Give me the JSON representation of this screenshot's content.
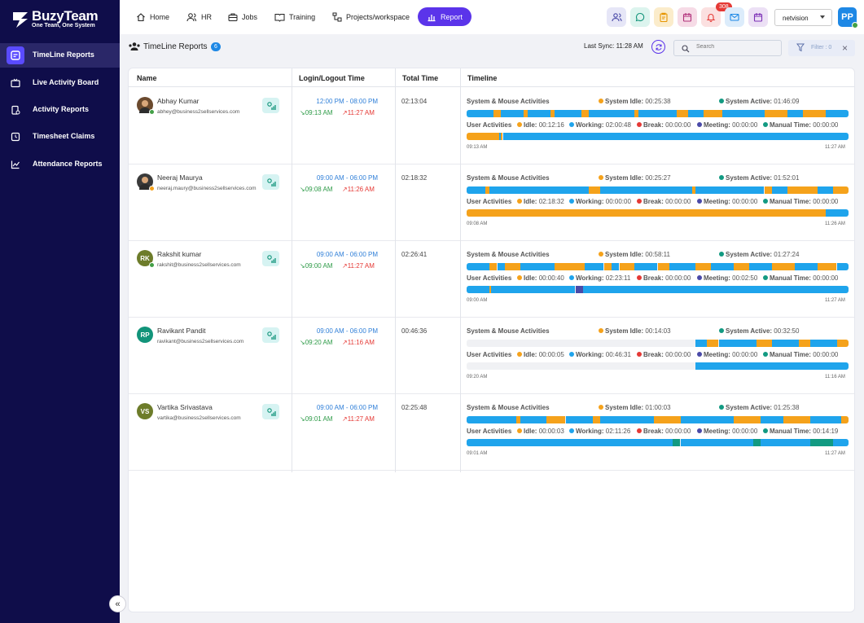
{
  "brand": {
    "name": "BuzyTeam",
    "tagline": "One Team, One System"
  },
  "sidebar": {
    "items": [
      {
        "label": "TimeLine Reports",
        "icon": "timeline-icon"
      },
      {
        "label": "Live Activity Board",
        "icon": "tv-icon"
      },
      {
        "label": "Activity Reports",
        "icon": "report-icon"
      },
      {
        "label": "Timesheet Claims",
        "icon": "clock-icon"
      },
      {
        "label": "Attendance Reports",
        "icon": "graph-icon"
      }
    ],
    "collapse": "«"
  },
  "topnav": {
    "items": [
      {
        "label": "Home",
        "icon": "home-icon"
      },
      {
        "label": "HR",
        "icon": "people-icon"
      },
      {
        "label": "Jobs",
        "icon": "briefcase-icon"
      },
      {
        "label": "Training",
        "icon": "book-icon"
      },
      {
        "label": "Projects/workspace",
        "icon": "workspace-icon"
      },
      {
        "label": "Report",
        "icon": "bar-chart-icon"
      }
    ],
    "notification_count": "308",
    "org_select": "netvision",
    "avatar": "PP"
  },
  "page": {
    "title": "TimeLine Reports",
    "count": "6",
    "last_sync": "Last Sync: 11:28 AM",
    "search_placeholder": "Search",
    "filter_label": "Filter : 0"
  },
  "table": {
    "headers": {
      "name": "Name",
      "login": "Login/Logout Time",
      "total": "Total Time",
      "timeline": "Timeline"
    },
    "labels": {
      "system": "System & Mouse Activities",
      "system_idle": "System Idle:",
      "system_active": "System Active:",
      "user": "User Activities",
      "idle": "Idle:",
      "working": "Working:",
      "break": "Break:",
      "meeting": "Meeting:",
      "manual": "Manual Time:"
    },
    "colors": {
      "active": "#1fa4ec",
      "idle": "#f5a21b",
      "break": "#e53935",
      "meeting": "#4a4aa8",
      "manual": "#129a82"
    },
    "rows": [
      {
        "name": "Abhay Kumar",
        "email": "abhey@business2sellservices.com",
        "avatar": "photo",
        "avatar_bg": "#6b4a2e",
        "status": "#43a047",
        "shift": "12:00 PM - 08:00 PM",
        "login": "09:13 AM",
        "logout": "11:27 AM",
        "total": "02:13:04",
        "system_idle": "00:25:38",
        "system_active": "01:46:09",
        "idle": "00:12:16",
        "working": "02:00:48",
        "break": "00:00:00",
        "meeting": "00:00:00",
        "manual": "00:00:00",
        "start": "09:13 AM",
        "end": "11:27 AM",
        "sys_bar": [
          [
            0,
            0.07,
            "a"
          ],
          [
            0.07,
            0.09,
            "i"
          ],
          [
            0.09,
            0.15,
            "a"
          ],
          [
            0.15,
            0.16,
            "i"
          ],
          [
            0.16,
            0.22,
            "a"
          ],
          [
            0.22,
            0.23,
            "i"
          ],
          [
            0.23,
            0.3,
            "a"
          ],
          [
            0.3,
            0.32,
            "i"
          ],
          [
            0.32,
            0.44,
            "a"
          ],
          [
            0.44,
            0.45,
            "i"
          ],
          [
            0.45,
            0.55,
            "a"
          ],
          [
            0.55,
            0.58,
            "i"
          ],
          [
            0.58,
            0.62,
            "a"
          ],
          [
            0.62,
            0.67,
            "i"
          ],
          [
            0.67,
            0.78,
            "a"
          ],
          [
            0.78,
            0.84,
            "i"
          ],
          [
            0.84,
            0.88,
            "a"
          ],
          [
            0.88,
            0.94,
            "i"
          ],
          [
            0.94,
            1,
            "a"
          ]
        ],
        "usr_bar": [
          [
            0,
            0.085,
            "i"
          ],
          [
            0.085,
            0.09,
            "a"
          ],
          [
            0.09,
            0.095,
            "i"
          ],
          [
            0.095,
            1,
            "a"
          ]
        ]
      },
      {
        "name": "Neeraj Maurya",
        "email": "neeraj.maury@business2sellservices.com",
        "avatar": "photo",
        "avatar_bg": "#3a3a3a",
        "status": "#f5a21b",
        "shift": "09:00 AM - 06:00 PM",
        "login": "09:08 AM",
        "logout": "11:26 AM",
        "total": "02:18:32",
        "system_idle": "00:25:27",
        "system_active": "01:52:01",
        "idle": "02:18:32",
        "working": "00:00:00",
        "break": "00:00:00",
        "meeting": "00:00:00",
        "manual": "00:00:00",
        "start": "09:08 AM",
        "end": "11:26 AM",
        "sys_bar": [
          [
            0,
            0.05,
            "a"
          ],
          [
            0.05,
            0.06,
            "i"
          ],
          [
            0.06,
            0.32,
            "a"
          ],
          [
            0.32,
            0.35,
            "i"
          ],
          [
            0.35,
            0.59,
            "a"
          ],
          [
            0.59,
            0.6,
            "i"
          ],
          [
            0.6,
            0.78,
            "a"
          ],
          [
            0.78,
            0.8,
            "i"
          ],
          [
            0.8,
            0.84,
            "a"
          ],
          [
            0.84,
            0.92,
            "i"
          ],
          [
            0.92,
            0.96,
            "a"
          ],
          [
            0.96,
            1,
            "i"
          ]
        ],
        "usr_bar": [
          [
            0,
            0.94,
            "i"
          ],
          [
            0.94,
            1,
            "a"
          ]
        ]
      },
      {
        "name": "Rakshit kumar",
        "email": "rakshit@business2sellservices.com",
        "avatar": "RK",
        "avatar_bg": "#6d7c2a",
        "status": "#43a047",
        "shift": "09:00 AM - 06:00 PM",
        "login": "09:00 AM",
        "logout": "11:27 AM",
        "total": "02:26:41",
        "system_idle": "00:58:11",
        "system_active": "01:27:24",
        "idle": "00:00:40",
        "working": "02:23:11",
        "break": "00:00:00",
        "meeting": "00:02:50",
        "manual": "00:00:00",
        "start": "09:00 AM",
        "end": "11:27 AM",
        "sys_bar": [
          [
            0,
            0.06,
            "a"
          ],
          [
            0.06,
            0.08,
            "i"
          ],
          [
            0.08,
            0.1,
            "a"
          ],
          [
            0.1,
            0.14,
            "i"
          ],
          [
            0.14,
            0.23,
            "a"
          ],
          [
            0.23,
            0.31,
            "i"
          ],
          [
            0.31,
            0.36,
            "a"
          ],
          [
            0.36,
            0.38,
            "i"
          ],
          [
            0.38,
            0.4,
            "a"
          ],
          [
            0.4,
            0.44,
            "i"
          ],
          [
            0.44,
            0.5,
            "a"
          ],
          [
            0.5,
            0.53,
            "i"
          ],
          [
            0.53,
            0.6,
            "a"
          ],
          [
            0.6,
            0.64,
            "i"
          ],
          [
            0.64,
            0.7,
            "a"
          ],
          [
            0.7,
            0.74,
            "i"
          ],
          [
            0.74,
            0.8,
            "a"
          ],
          [
            0.8,
            0.86,
            "i"
          ],
          [
            0.86,
            0.92,
            "a"
          ],
          [
            0.92,
            0.97,
            "i"
          ],
          [
            0.97,
            1,
            "a"
          ]
        ],
        "usr_bar": [
          [
            0,
            0.06,
            "a"
          ],
          [
            0.06,
            0.065,
            "i"
          ],
          [
            0.065,
            0.285,
            "a"
          ],
          [
            0.285,
            0.305,
            "m"
          ],
          [
            0.305,
            1,
            "a"
          ]
        ]
      },
      {
        "name": "Ravikant Pandit",
        "email": "ravikant@business2sellservices.com",
        "avatar": "RP",
        "avatar_bg": "#12947a",
        "status": "",
        "shift": "09:00 AM - 06:00 PM",
        "login": "09:20 AM",
        "logout": "11:16 AM",
        "total": "00:46:36",
        "system_idle": "00:14:03",
        "system_active": "00:32:50",
        "idle": "00:00:05",
        "working": "00:46:31",
        "break": "00:00:00",
        "meeting": "00:00:00",
        "manual": "00:00:00",
        "start": "09:20 AM",
        "end": "11:16 AM",
        "sys_bar": [
          [
            0.6,
            0.63,
            "a"
          ],
          [
            0.63,
            0.66,
            "i"
          ],
          [
            0.66,
            0.76,
            "a"
          ],
          [
            0.76,
            0.8,
            "i"
          ],
          [
            0.8,
            0.87,
            "a"
          ],
          [
            0.87,
            0.9,
            "i"
          ],
          [
            0.9,
            0.97,
            "a"
          ],
          [
            0.97,
            1,
            "i"
          ]
        ],
        "usr_bar": [
          [
            0.6,
            1,
            "a"
          ]
        ]
      },
      {
        "name": "Vartika Srivastava",
        "email": "vartika@business2sellservices.com",
        "avatar": "VS",
        "avatar_bg": "#6d7c2a",
        "status": "",
        "shift": "09:00 AM - 06:00 PM",
        "login": "09:01 AM",
        "logout": "11:27 AM",
        "total": "02:25:48",
        "system_idle": "01:00:03",
        "system_active": "01:25:38",
        "idle": "00:00:03",
        "working": "02:11:26",
        "break": "00:00:00",
        "meeting": "00:00:00",
        "manual": "00:14:19",
        "start": "09:01 AM",
        "end": "11:27 AM",
        "sys_bar": [
          [
            0,
            0.13,
            "a"
          ],
          [
            0.13,
            0.14,
            "i"
          ],
          [
            0.14,
            0.21,
            "a"
          ],
          [
            0.21,
            0.26,
            "i"
          ],
          [
            0.26,
            0.33,
            "a"
          ],
          [
            0.33,
            0.35,
            "i"
          ],
          [
            0.35,
            0.49,
            "a"
          ],
          [
            0.49,
            0.56,
            "i"
          ],
          [
            0.56,
            0.7,
            "a"
          ],
          [
            0.7,
            0.77,
            "i"
          ],
          [
            0.77,
            0.83,
            "a"
          ],
          [
            0.83,
            0.9,
            "i"
          ],
          [
            0.9,
            0.98,
            "a"
          ],
          [
            0.98,
            1,
            "i"
          ]
        ],
        "usr_bar": [
          [
            0,
            0.54,
            "a"
          ],
          [
            0.54,
            0.56,
            "g"
          ],
          [
            0.56,
            0.75,
            "a"
          ],
          [
            0.75,
            0.77,
            "g"
          ],
          [
            0.77,
            0.9,
            "a"
          ],
          [
            0.9,
            0.96,
            "g"
          ],
          [
            0.96,
            1,
            "a"
          ]
        ]
      }
    ]
  }
}
